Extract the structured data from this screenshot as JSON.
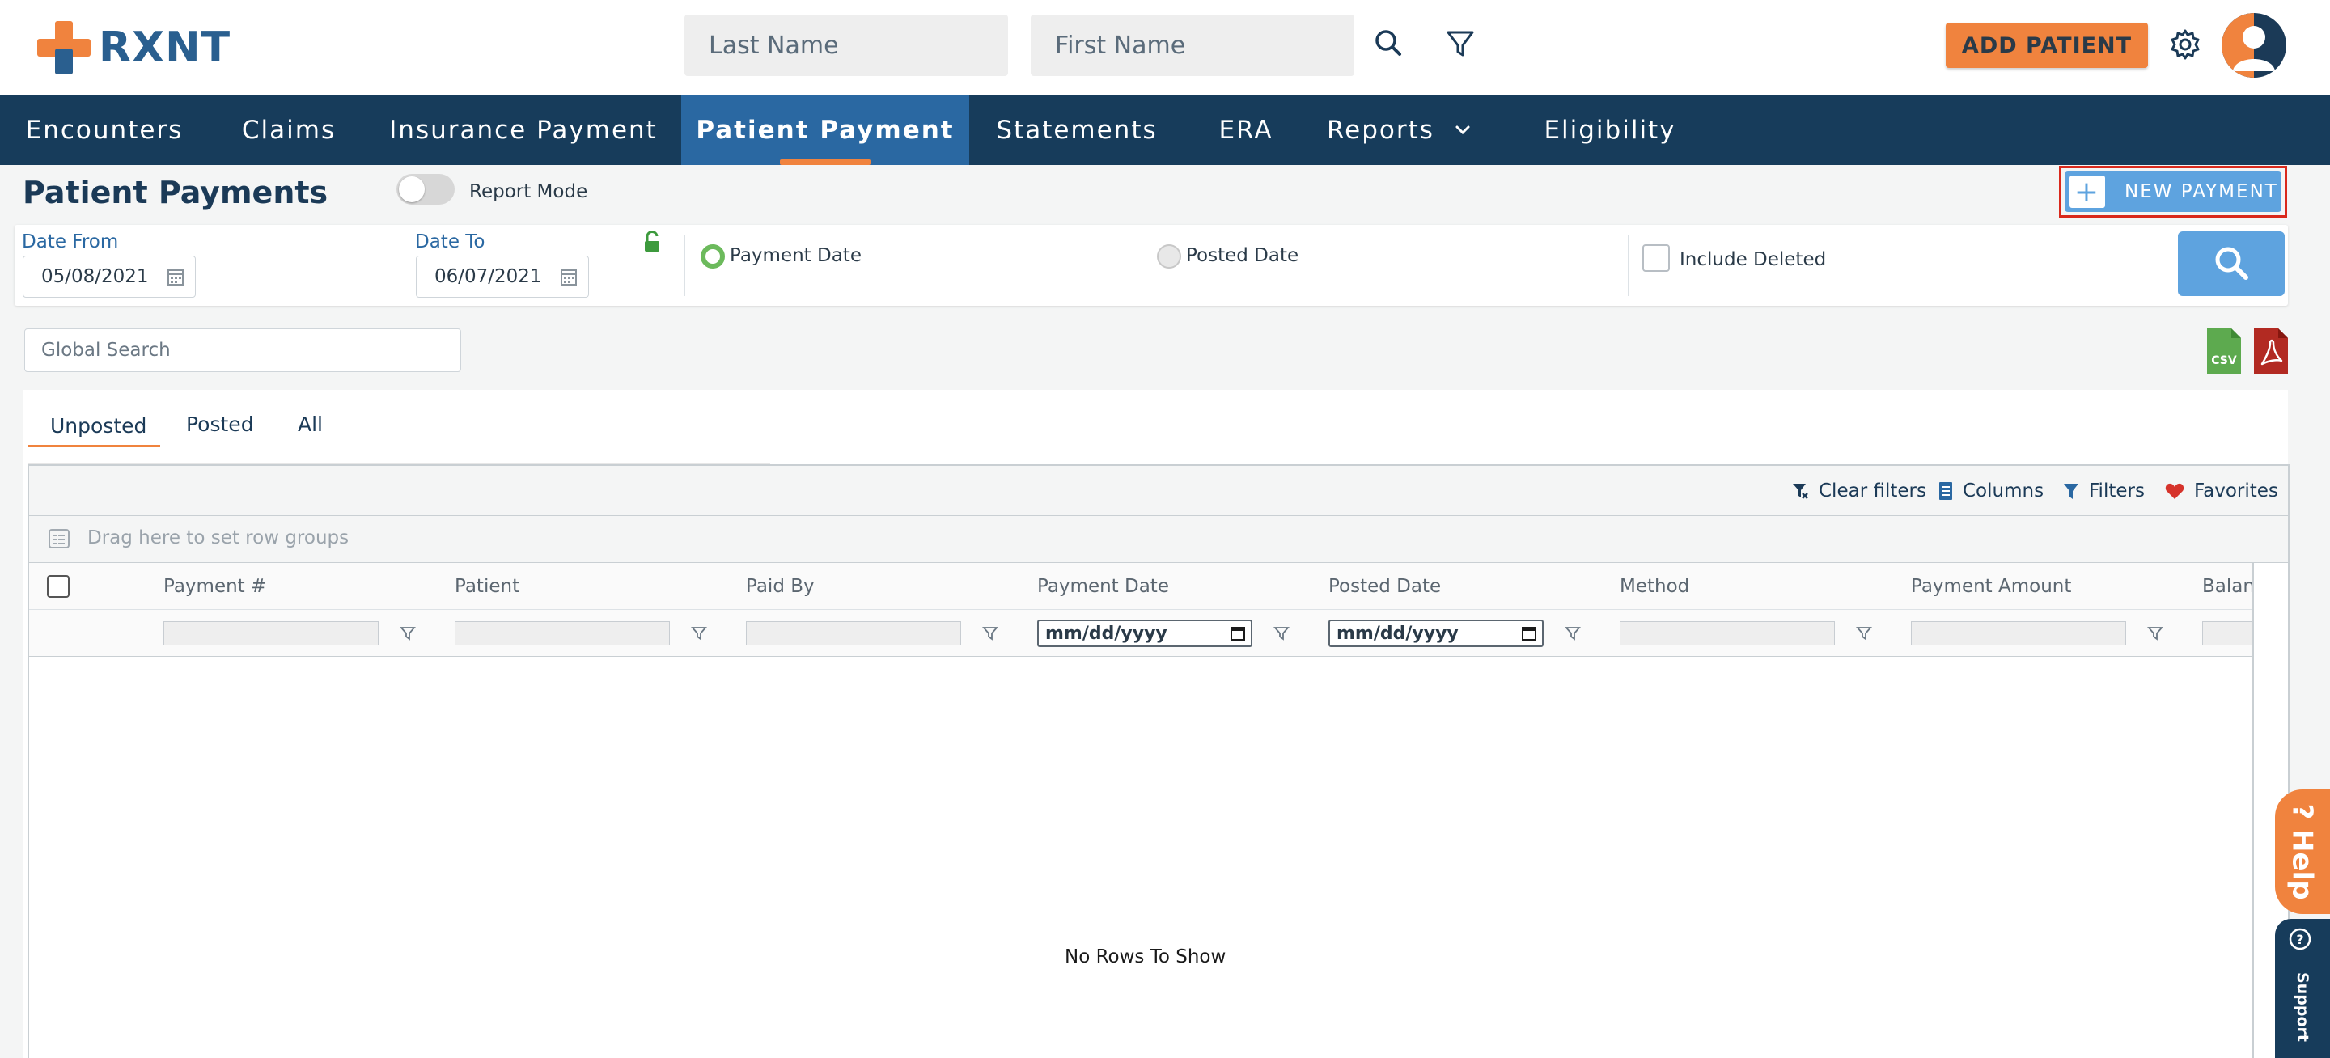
{
  "brand": {
    "name": "RXNT",
    "primary_color": "#2a5f8f",
    "accent_color": "#f0833e",
    "nav_color": "#173c5b"
  },
  "header": {
    "last_name_placeholder": "Last Name",
    "first_name_placeholder": "First Name",
    "add_patient_label": "ADD PATIENT"
  },
  "nav": {
    "items": [
      "Encounters",
      "Claims",
      "Insurance Payment",
      "Patient Payment",
      "Statements",
      "ERA",
      "Reports",
      "Eligibility"
    ],
    "active": "Patient Payment"
  },
  "page": {
    "title": "Patient Payments",
    "report_mode_label": "Report Mode",
    "report_mode_on": false,
    "new_payment_label": "NEW PAYMENT"
  },
  "filters": {
    "date_from_label": "Date From",
    "date_from_value": "05/08/2021",
    "date_to_label": "Date To",
    "date_to_value": "06/07/2021",
    "payment_date_label": "Payment Date",
    "posted_date_label": "Posted Date",
    "selected_date_type": "Payment Date",
    "include_deleted_label": "Include Deleted",
    "include_deleted_checked": false
  },
  "global_search": {
    "placeholder": "Global Search"
  },
  "export": {
    "csv_label": "CSV"
  },
  "tabs": {
    "items": [
      "Unposted",
      "Posted",
      "All"
    ],
    "active": "Unposted"
  },
  "grid": {
    "toolbar": {
      "clear_filters_label": "Clear filters",
      "columns_label": "Columns",
      "filters_label": "Filters",
      "favorites_label": "Favorites"
    },
    "row_group_hint": "Drag here to set row groups",
    "columns": [
      "Payment #",
      "Patient",
      "Paid By",
      "Payment Date",
      "Posted Date",
      "Method",
      "Payment Amount",
      "Balan"
    ],
    "date_placeholder": "mm/dd/yyyy",
    "empty_message": "No Rows To Show"
  },
  "help": {
    "help_label": "Help",
    "support_label": "Support"
  }
}
